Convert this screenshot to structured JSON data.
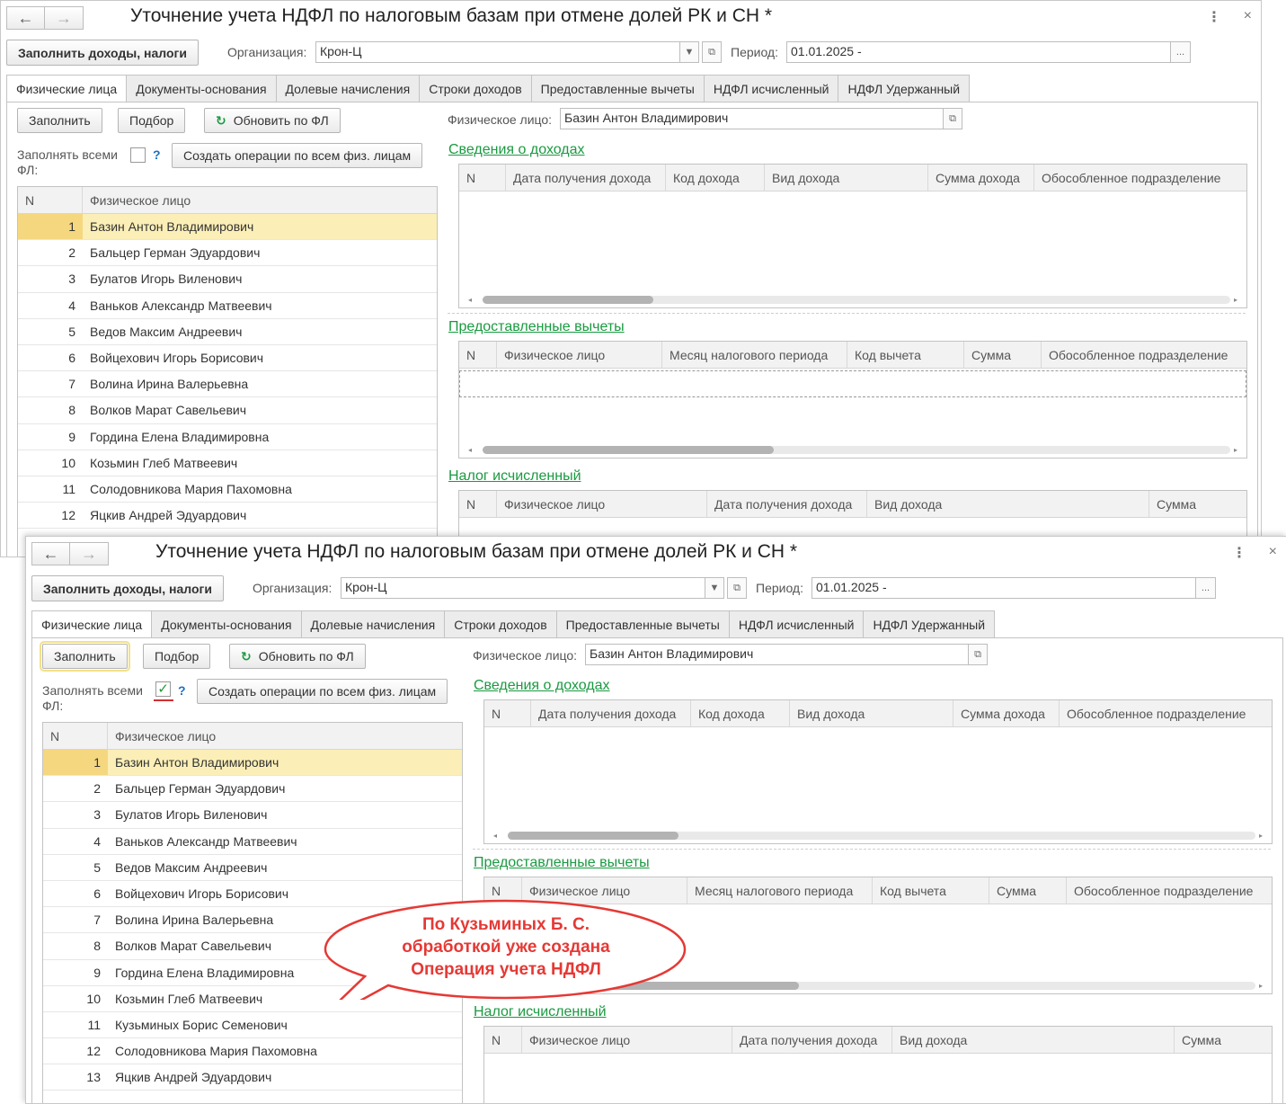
{
  "window": {
    "title": "Уточнение учета НДФЛ по налоговым базам при отмене долей РК и СН *",
    "back_icon": "←",
    "forward_icon": "→",
    "more_icon": "⋮",
    "close_icon": "×"
  },
  "toolbar": {
    "fill_income_taxes": "Заполнить доходы, налоги",
    "org_label": "Организация:",
    "org_value": "Крон-Ц",
    "period_label": "Период:",
    "period_value": "01.01.2025 -",
    "ellipsis": "..."
  },
  "tabs": [
    {
      "label": "Физические лица"
    },
    {
      "label": "Документы-основания"
    },
    {
      "label": "Долевые начисления"
    },
    {
      "label": "Строки доходов"
    },
    {
      "label": "Предоставленные вычеты"
    },
    {
      "label": "НДФЛ исчисленный"
    },
    {
      "label": "НДФЛ Удержанный"
    }
  ],
  "left_panel": {
    "fill": "Заполнить",
    "select": "Подбор",
    "refresh": "Обновить по ФЛ",
    "fill_all_label_1": "Заполнять всеми",
    "fill_all_label_2": "ФЛ:",
    "help": "?",
    "create_ops": "Создать операции по всем физ. лицам",
    "col_n": "N",
    "col_person": "Физическое лицо"
  },
  "people_1": [
    {
      "n": "1",
      "name": "Базин Антон Владимирович"
    },
    {
      "n": "2",
      "name": "Бальцер Герман Эдуардович"
    },
    {
      "n": "3",
      "name": "Булатов Игорь Виленович"
    },
    {
      "n": "4",
      "name": "Ваньков Александр Матвеевич"
    },
    {
      "n": "5",
      "name": "Ведов Максим Андреевич"
    },
    {
      "n": "6",
      "name": "Войцехович Игорь Борисович"
    },
    {
      "n": "7",
      "name": "Волина Ирина Валерьевна"
    },
    {
      "n": "8",
      "name": "Волков Марат Савельевич"
    },
    {
      "n": "9",
      "name": "Гордина Елена Владимировна"
    },
    {
      "n": "10",
      "name": "Козьмин Глеб Матвеевич"
    },
    {
      "n": "11",
      "name": "Солодовникова Мария Пахомовна"
    },
    {
      "n": "12",
      "name": "Яцкив Андрей Эдуардович"
    }
  ],
  "people_2": [
    {
      "n": "1",
      "name": "Базин Антон Владимирович"
    },
    {
      "n": "2",
      "name": "Бальцер Герман Эдуардович"
    },
    {
      "n": "3",
      "name": "Булатов Игорь Виленович"
    },
    {
      "n": "4",
      "name": "Ваньков Александр Матвеевич"
    },
    {
      "n": "5",
      "name": "Ведов Максим Андреевич"
    },
    {
      "n": "6",
      "name": "Войцехович Игорь Борисович"
    },
    {
      "n": "7",
      "name": "Волина Ирина Валерьевна"
    },
    {
      "n": "8",
      "name": "Волков Марат Савельевич"
    },
    {
      "n": "9",
      "name": "Гордина Елена Владимировна"
    },
    {
      "n": "10",
      "name": "Козьмин Глеб Матвеевич"
    },
    {
      "n": "11",
      "name": "Кузьминых Борис Семенович"
    },
    {
      "n": "12",
      "name": "Солодовникова Мария Пахомовна"
    },
    {
      "n": "13",
      "name": "Яцкив Андрей Эдуардович"
    }
  ],
  "right_panel": {
    "person_label": "Физическое лицо:",
    "person_value": "Базин Антон Владимирович",
    "income_title": "Сведения о доходах",
    "income_cols": [
      "N",
      "Дата получения дохода",
      "Код дохода",
      "Вид дохода",
      "Сумма дохода",
      "Обособленное подразделение"
    ],
    "deductions_title": "Предоставленные вычеты",
    "deduction_cols": [
      "N",
      "Физическое лицо",
      "Месяц налогового периода",
      "Код вычета",
      "Сумма",
      "Обособленное подразделение"
    ],
    "tax_title": "Налог исчисленный",
    "tax_cols": [
      "N",
      "Физическое лицо",
      "Дата получения дохода",
      "Вид дохода",
      "Сумма"
    ]
  },
  "callout": {
    "line1": "По Кузьминых Б. С.",
    "line2": "обработкой уже создана",
    "line3": "Операция учета НДФЛ"
  },
  "colors": {
    "accent_green": "#1a9a41",
    "selected_row": "#fbefb7",
    "callout_red": "#e53935"
  }
}
